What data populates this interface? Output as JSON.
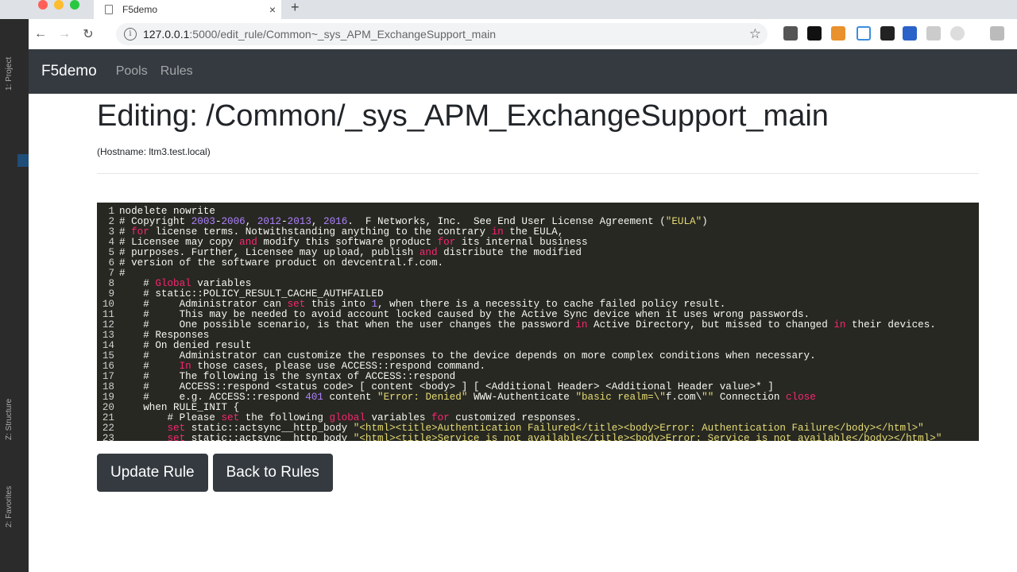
{
  "browser": {
    "tab_title": "F5demo",
    "tab_close": "×",
    "new_tab": "+",
    "url_host": "127.0.0.1",
    "url_path": ":5000/edit_rule/Common~_sys_APM_ExchangeSupport_main",
    "back": "←",
    "forward": "→",
    "reload": "↻",
    "star": "☆",
    "info": "i"
  },
  "ide": {
    "project_label": "1: Project",
    "structure_label": "Z: Structure",
    "favorites_label": "2: Favorites"
  },
  "navbar": {
    "brand": "F5demo",
    "links": [
      "Pools",
      "Rules"
    ]
  },
  "page": {
    "title": "Editing: /Common/_sys_APM_ExchangeSupport_main",
    "hostname": "(Hostname: ltm3.test.local)"
  },
  "editor": {
    "lines": [
      {
        "n": "1",
        "t": "nodelete nowrite"
      },
      {
        "n": "2",
        "t": "# Copyright 2003-2006, 2012-2013, 2016.  F5 Networks, Inc.  See End User License Agreement (\"EULA\")"
      },
      {
        "n": "3",
        "t": "# for license terms. Notwithstanding anything to the contrary in the EULA,"
      },
      {
        "n": "4",
        "t": "# Licensee may copy and modify this software product for its internal business"
      },
      {
        "n": "5",
        "t": "# purposes. Further, Licensee may upload, publish and distribute the modified"
      },
      {
        "n": "6",
        "t": "# version of the software product on devcentral.f5.com."
      },
      {
        "n": "7",
        "t": "#"
      },
      {
        "n": "8",
        "t": "    # Global variables"
      },
      {
        "n": "9",
        "t": "    # static::POLICY_RESULT_CACHE_AUTHFAILED"
      },
      {
        "n": "10",
        "t": "    #     Administrator can set this into 1, when there is a necessity to cache failed policy result."
      },
      {
        "n": "11",
        "t": "    #     This may be needed to avoid account locked caused by the Active Sync device when it uses wrong passwords."
      },
      {
        "n": "12",
        "t": "    #     One possible scenario, is that when the user changes the password in Active Directory, but missed to changed in their devices."
      },
      {
        "n": "13",
        "t": "    # Responses"
      },
      {
        "n": "14",
        "t": "    # On denied result"
      },
      {
        "n": "15",
        "t": "    #     Administrator can customize the responses to the device depends on more complex conditions when necessary."
      },
      {
        "n": "16",
        "t": "    #     In those cases, please use ACCESS::respond command."
      },
      {
        "n": "17",
        "t": "    #     The following is the syntax of ACCESS::respond"
      },
      {
        "n": "18",
        "t": "    #     ACCESS::respond <status code> [ content <body> ] [ <Additional Header> <Additional Header value>* ]"
      },
      {
        "n": "19",
        "t": "    #     e.g. ACCESS::respond 401 content \"Error: Denied\" WWW-Authenticate \"basic realm=\\\"f5.com\\\"\" Connection close"
      },
      {
        "n": "20",
        "t": "    when RULE_INIT {"
      },
      {
        "n": "21",
        "t": "        # Please set the following global variables for customized responses."
      },
      {
        "n": "22",
        "t": "        set static::actsync_401_http_body \"<html><title>Authentication Failured</title><body>Error: Authentication Failure</body></html>\""
      },
      {
        "n": "23",
        "t": "        set static::actsync_503_http_body \"<html><title>Service is not available</title><body>Error: Service is not available</body></html>\""
      }
    ]
  },
  "buttons": {
    "update": "Update Rule",
    "back": "Back to Rules"
  }
}
